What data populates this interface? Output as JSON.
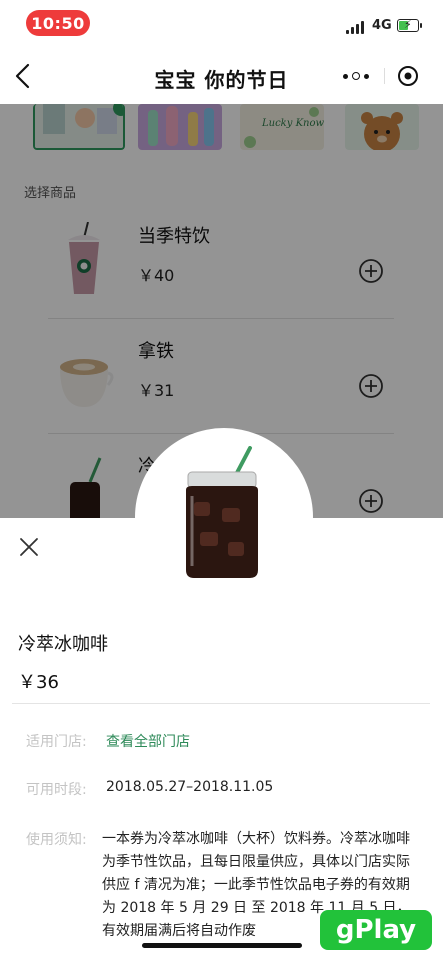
{
  "status_bar": {
    "time": "10:50",
    "network": "4G"
  },
  "nav": {
    "title": "宝宝 你的节日",
    "icons": {
      "back": "chevron-left-icon",
      "more": "more-dots-icon",
      "close": "target-icon"
    }
  },
  "cards": [
    {
      "name": "card-1",
      "selected": true
    },
    {
      "name": "card-2",
      "selected": false
    },
    {
      "name": "card-3",
      "text": "Lucky Know you",
      "selected": false
    },
    {
      "name": "card-4",
      "selected": false
    }
  ],
  "products_section": {
    "label": "选择商品",
    "items": [
      {
        "name": "当季特饮",
        "price": "￥40"
      },
      {
        "name": "拿铁",
        "price": "￥31"
      },
      {
        "name": "冷",
        "price": ""
      }
    ]
  },
  "sheet": {
    "product_name": "冷萃冰咖啡",
    "price": "￥36",
    "store_label": "适用门店:",
    "store_link": "查看全部门店",
    "period_label": "可用时段:",
    "period_value": "2018.05.27–2018.11.05",
    "notice_label": "使用须知:",
    "notice_text": "一本券为冷萃冰咖啡（大杯）饮料券。冷萃冰咖啡为季节性饮品，且每日限量供应，具体以门店实际供应 f 清况为准；一此季节性饮品电子券的有效期为 2018 年 5 月 29 日 至 2018 年 11 月 5 日，有效期届满后将自动作废"
  },
  "watermark": {
    "text": "gPlay"
  },
  "colors": {
    "accent_green": "#2e8a59",
    "time_pill": "#ee3b3b",
    "watermark": "#22c23a"
  }
}
